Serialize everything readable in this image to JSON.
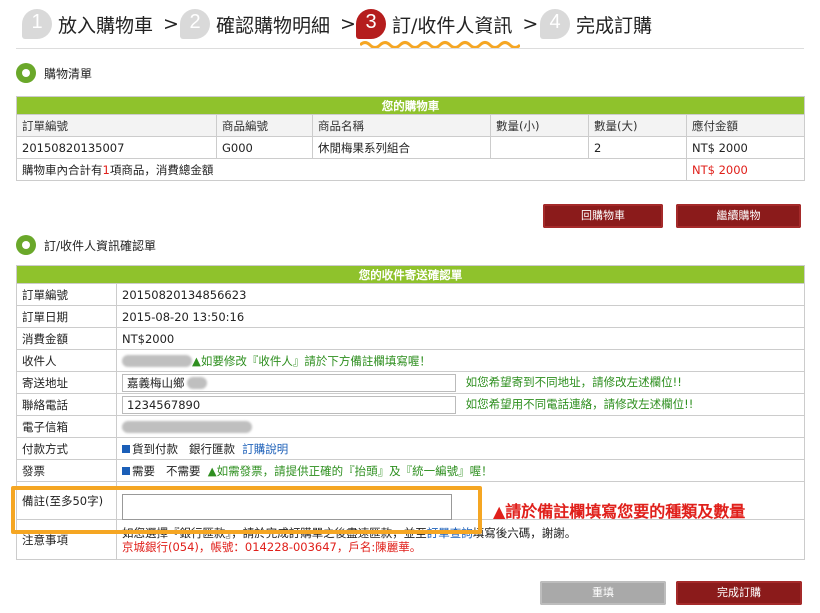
{
  "steps": [
    {
      "num": "1",
      "label": "放入購物車",
      "arrow": ">"
    },
    {
      "num": "2",
      "label": "確認購物明細",
      "arrow": ">"
    },
    {
      "num": "3",
      "label": "訂/收件人資訊",
      "arrow": ">"
    },
    {
      "num": "4",
      "label": "完成訂購",
      "arrow": ""
    }
  ],
  "cart": {
    "section_title": "購物清單",
    "table_title": "您的購物車",
    "headers": [
      "訂單編號",
      "商品編號",
      "商品名稱",
      "數量(小)",
      "數量(大)",
      "應付金額"
    ],
    "row": [
      "20150820135007",
      "G000",
      "休閒梅果系列組合",
      "",
      "2",
      "NT$ 2000"
    ],
    "summary_prefix": "購物車內合計有",
    "summary_count": "1",
    "summary_suffix": "項商品，消費總金額",
    "summary_total": "NT$ 2000",
    "back_button": "回購物車",
    "continue_button": "繼續購物"
  },
  "form": {
    "section_title": "訂/收件人資訊確認單",
    "table_title": "您的收件寄送確認單",
    "order_no_label": "訂單編號",
    "order_no": "20150820134856623",
    "order_date_label": "訂單日期",
    "order_date": "2015-08-20 13:50:16",
    "amount_label": "消費金額",
    "amount": "NT$2000",
    "recipient_label": "收件人",
    "recipient_note": "▲如要修改『收件人』請於下方備註欄填寫喔！",
    "address_label": "寄送地址",
    "address_value": "嘉義梅山鄉",
    "address_note": "如您希望寄到不同地址，請修改左述欄位!!",
    "phone_label": "聯絡電話",
    "phone_value": "1234567890",
    "phone_note": "如您希望用不同電話連絡，請修改左述欄位!!",
    "email_label": "電子信箱",
    "payment_label": "付款方式",
    "payment_cod": "貨到付款",
    "payment_bank": "銀行匯款",
    "payment_help": "訂購說明",
    "invoice_label": "發票",
    "invoice_yes": "需要",
    "invoice_no": "不需要",
    "invoice_note": "▲如需發票，請提供正確的『抬頭』及『統一編號』喔！",
    "remark_label": "備註(至多50字)",
    "remark_value": "",
    "remark_hint": "▲請於備註欄填寫您要的種類及數量",
    "notice_label": "注意事項",
    "notice_line1_a": "如您選擇『銀行匯款』，請於完成訂購單之後盡速匯款，並至",
    "notice_link": "訂單查詢",
    "notice_line1_b": "填寫後六碼，謝謝。",
    "notice_line2": "京城銀行(054)，帳號：014228-003647，戶名:陳麗華。"
  },
  "actions": {
    "reset_button": "重填",
    "submit_button": "完成訂購"
  },
  "colors": {
    "accent_green": "#8fc22c",
    "button_red": "#8b1b1b",
    "highlight_orange": "#f5a623",
    "alert_red": "#e0201b"
  }
}
